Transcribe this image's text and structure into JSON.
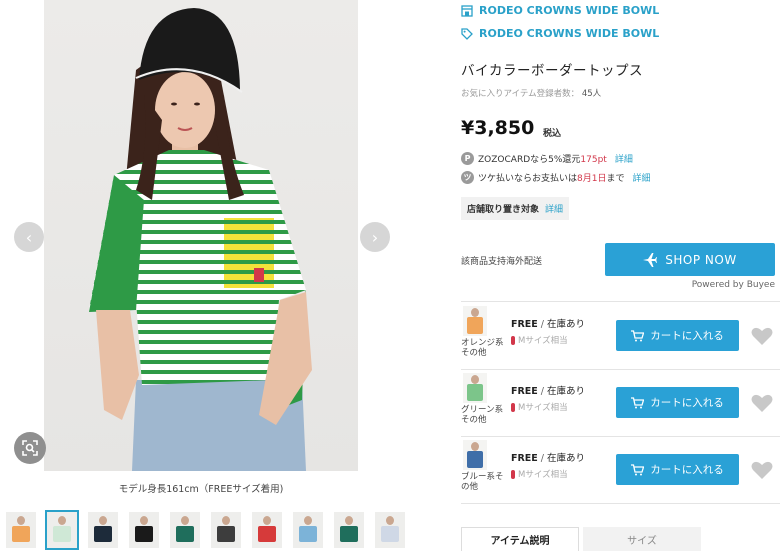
{
  "gallery": {
    "caption": "モデル身長161cm（FREEサイズ着用)",
    "thumbnail_colors": [
      "#f0a55a",
      "#cfe8d6",
      "#1d2b3a",
      "#1a1a1a",
      "#1f6e5c",
      "#3d3d3d",
      "#d63a3a",
      "#7cb3d8",
      "#1f6e5c",
      "#cfd8e6"
    ],
    "active_thumbnail": 1
  },
  "brands": {
    "shop_label": "RODEO CROWNS WIDE BOWL",
    "tag_label": "RODEO CROWNS WIDE BOWL"
  },
  "product": {
    "title": "バイカラーボーダートップス",
    "fav_label": "お気に入りアイテム登録者数：",
    "fav_count": "45人",
    "price": "¥3,850",
    "tax_label": "税込"
  },
  "points": {
    "zozocard_prefix": "ZOZOCARDなら5%還元",
    "zozocard_pt": "175pt",
    "detail": "詳細",
    "tsuke_prefix": "ツケ払いならお支払いは",
    "tsuke_date": "8月1日",
    "tsuke_suffix": "まで",
    "detail2": "詳細"
  },
  "store": {
    "label": "店舗取り置き対象",
    "detail": "詳細"
  },
  "overseas": {
    "label": "該商品支持海外配送",
    "shop_now": "SHOP NOW",
    "powered": "Powered by Buyee"
  },
  "variants": [
    {
      "color1": "オレンジ系",
      "color2": "その他",
      "size": "FREE",
      "stock": "在庫あり",
      "fit": "Mサイズ相当",
      "cart": "カートに入れる",
      "swatch": "#f0a55a"
    },
    {
      "color1": "グリーン系",
      "color2": "その他",
      "size": "FREE",
      "stock": "在庫あり",
      "fit": "Mサイズ相当",
      "cart": "カートに入れる",
      "swatch": "#7cc58a"
    },
    {
      "color1": "ブルー系そ",
      "color2": "の他",
      "size": "FREE",
      "stock": "在庫あり",
      "fit": "Mサイズ相当",
      "cart": "カートに入れる",
      "swatch": "#3f6ea8"
    }
  ],
  "tabs": {
    "item_desc": "アイテム説明",
    "size": "サイズ"
  },
  "colors": {
    "accent": "#2aa1d6",
    "price_red": "#d2374a"
  }
}
